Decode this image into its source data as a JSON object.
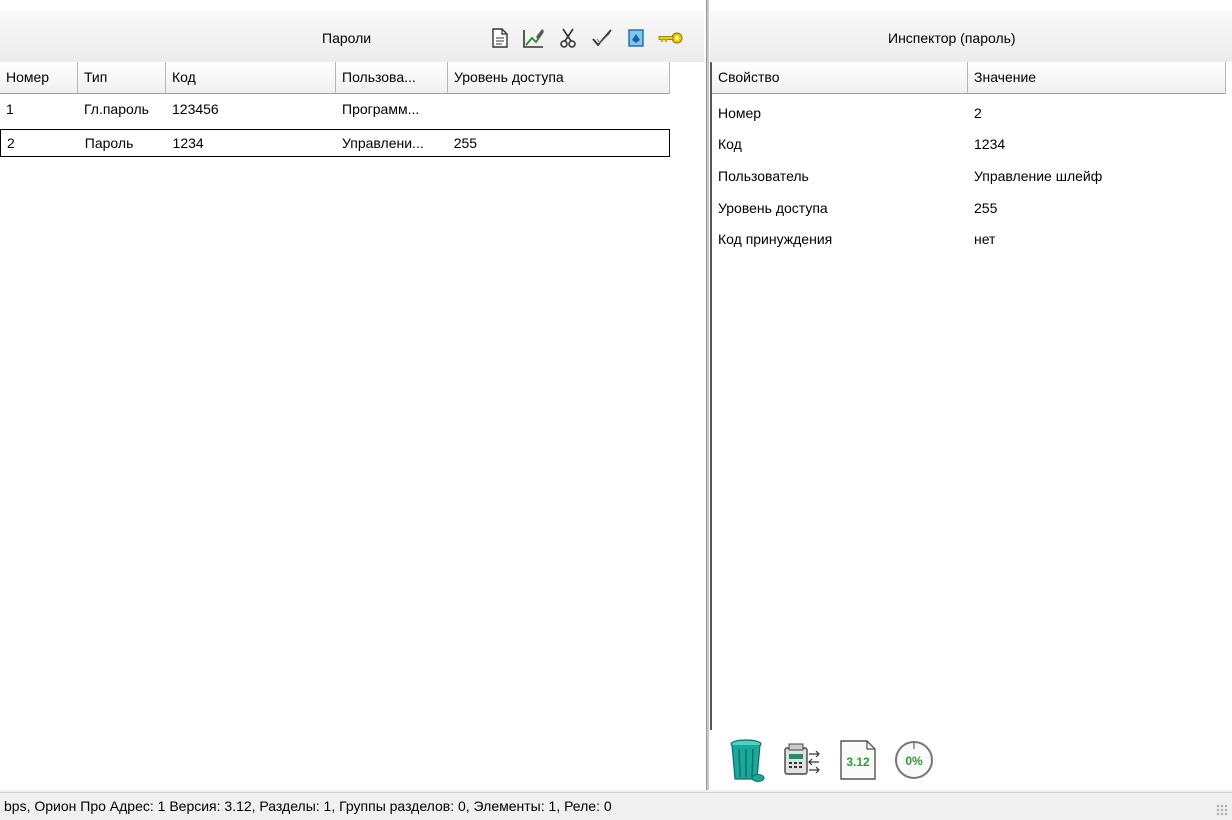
{
  "passwords": {
    "title": "Пароли",
    "columns": [
      "Номер",
      "Тип",
      "Код",
      "Пользова...",
      "Уровень доступа"
    ],
    "rows": [
      {
        "num": "1",
        "type": "Гл.пароль",
        "code": "123456",
        "user": "Программ...",
        "level": ""
      },
      {
        "num": "2",
        "type": "Пароль",
        "code": "1234",
        "user": "Управлени...",
        "level": "255"
      }
    ],
    "toolbar": [
      "new-document-icon",
      "edit-icon",
      "cut-icon",
      "check-icon",
      "blue-tag-icon",
      "key-icon"
    ]
  },
  "inspector": {
    "title": "Инспектор (пароль)",
    "columns": [
      "Свойство",
      "Значение"
    ],
    "rows": [
      {
        "name": "Номер",
        "value": "2"
      },
      {
        "name": "Код",
        "value": "1234"
      },
      {
        "name": "Пользователь",
        "value": "Управление шлейф"
      },
      {
        "name": "Уровень доступа",
        "value": "255"
      },
      {
        "name": "Код принуждения",
        "value": "нет"
      }
    ],
    "bottom_icons": {
      "version": "3.12",
      "progress": "0%"
    }
  },
  "status": {
    "text": "bps, Орион Про Адрес: 1 Версия: 3.12, Разделы: 1, Группы разделов: 0, Элементы: 1, Реле: 0"
  },
  "colors": {
    "trash": "#1aa89c",
    "key": "#e8c800",
    "progress_green": "#2e9e2e"
  }
}
